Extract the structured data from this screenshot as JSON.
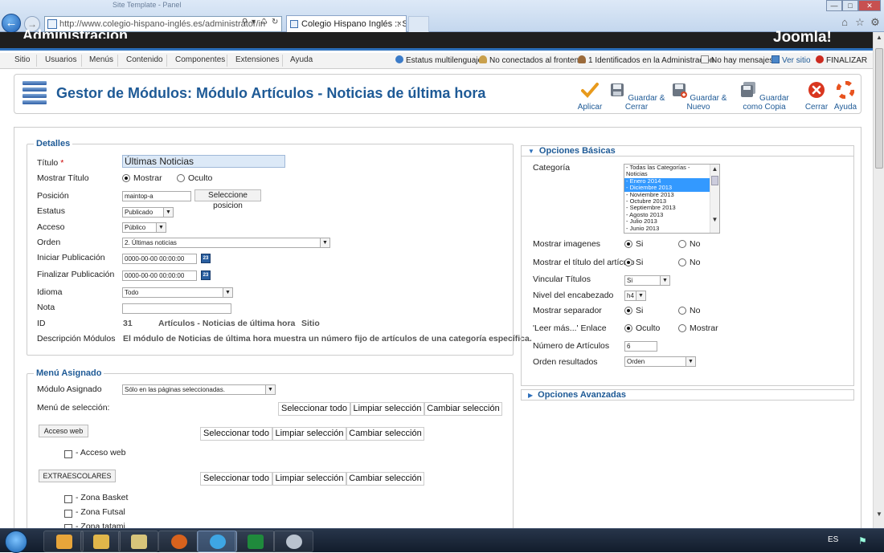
{
  "browser": {
    "doc_title": "Site Template - Panel",
    "url": "http://www.colegio-hispano-inglés.es/administrator/in",
    "tab_title": "Colegio Hispano Inglés :: Sa...",
    "tab_close": "×"
  },
  "joomla": {
    "admin_title": "Administración",
    "logo_text": "Joomla!"
  },
  "menubar": {
    "items": [
      "Sitio",
      "Usuarios",
      "Menús",
      "Contenido",
      "Componentes",
      "Extensiones",
      "Ayuda"
    ],
    "status": {
      "multilang": "Estatus multilenguaje",
      "frontend": "No conectados al frontend",
      "admin": "1 Identificados en la Administración",
      "messages": "No hay mensajes",
      "view_site": "Ver sitio",
      "logout": "FINALIZAR"
    }
  },
  "toolbar": {
    "title": "Gestor de Módulos: Módulo Artículos - Noticias de última hora",
    "buttons": {
      "apply": "Aplicar",
      "save_close": "Guardar & Cerrar",
      "save_new": "Guardar & Nuevo",
      "save_copy": "Guardar como Copia",
      "close": "Cerrar",
      "help": "Ayuda"
    }
  },
  "details": {
    "legend": "Detalles",
    "title_label": "Título",
    "required_mark": "*",
    "title_value": "Últimas Noticias",
    "show_title_label": "Mostrar Título",
    "show_title_opts": [
      "Mostrar",
      "Oculto"
    ],
    "position_label": "Posición",
    "position_value": "maintop-a",
    "position_btn": "Seleccione posicion",
    "status_label": "Estatus",
    "status_value": "Publicado",
    "access_label": "Acceso",
    "access_value": "Público",
    "order_label": "Orden",
    "order_value": "2. Últimas noticias",
    "start_pub_label": "Iniciar Publicación",
    "start_pub_value": "0000-00-00 00:00:00",
    "end_pub_label": "Finalizar Publicación",
    "end_pub_value": "0000-00-00 00:00:00",
    "cal_icon": "23",
    "language_label": "Idioma",
    "language_value": "Todo",
    "note_label": "Nota",
    "note_value": "",
    "id_label": "ID",
    "id_value": "31",
    "id_module": "Artículos - Noticias de última hora",
    "id_site": "Sitio",
    "desc_label": "Descripción Módulos",
    "desc_value": "El módulo de Noticias de última hora muestra un número fijo de artículos de una categoría específica."
  },
  "menu_assign": {
    "legend": "Menú Asignado",
    "module_label": "Módulo Asignado",
    "module_value": "Sólo en las páginas seleccionadas.",
    "selection_label": "Menú de selección:",
    "select_all": "Seleccionar todo",
    "clear": "Limpiar selección",
    "toggle": "Cambiar selección",
    "groups": [
      {
        "name": "Acceso web",
        "items": [
          "- Acceso web"
        ]
      },
      {
        "name": "EXTRAESCOLARES",
        "items": [
          "- Zona Basket",
          "- Zona Futsal",
          "- Zona tatami"
        ]
      }
    ]
  },
  "basic": {
    "header": "Opciones Básicas",
    "category_label": "Categoría",
    "categories": [
      "- Todas las Categorías -",
      "Noticias",
      "- Enero 2014",
      "- Diciembre 2013",
      "- Noviembre 2013",
      "- Octubre 2013",
      "- Septiembre 2013",
      "- Agosto 2013",
      "- Julio 2013",
      "- Junio 2013"
    ],
    "show_images_label": "Mostrar imagenes",
    "show_article_title_label": "Mostrar el título del artículo",
    "link_titles_label": "Vincular Títulos",
    "link_titles_value": "Si",
    "heading_level_label": "Nivel del encabezado",
    "heading_level_value": "h4",
    "separator_label": "Mostrar separador",
    "readmore_label": "'Leer más...' Enlace",
    "readmore_opts": [
      "Oculto",
      "Mostrar"
    ],
    "num_articles_label": "Número de Artículos",
    "num_articles_value": "6",
    "order_results_label": "Orden resultados",
    "order_results_value": "Orden",
    "yes": "Si",
    "no": "No"
  },
  "advanced": {
    "header": "Opciones Avanzadas"
  },
  "taskbar": {
    "lang": "ES"
  }
}
